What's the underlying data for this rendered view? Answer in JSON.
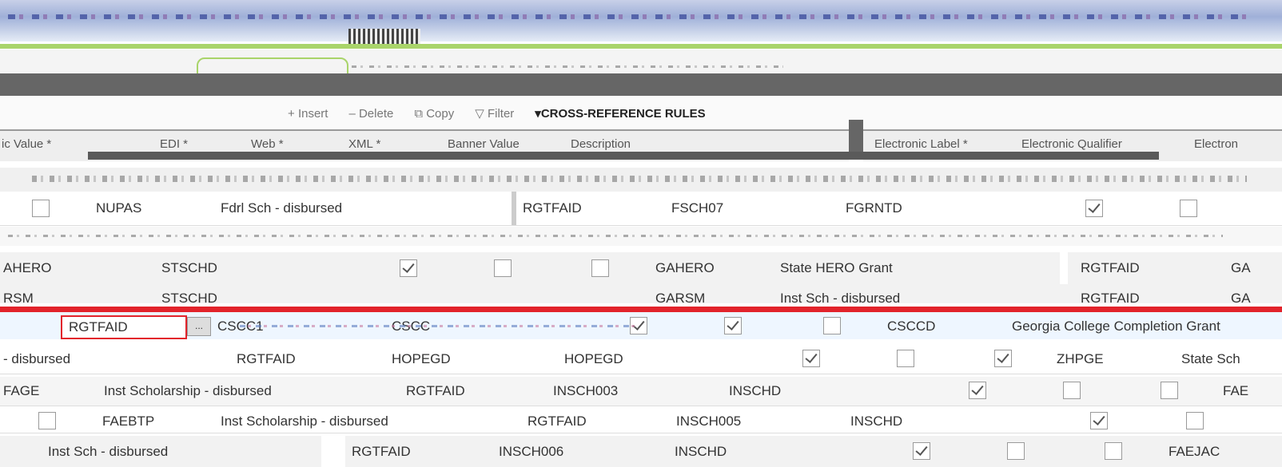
{
  "colors": {
    "accent_green": "#a9d46a",
    "highlight_red": "#e2232b",
    "header_gray": "#dadada",
    "toolbar_dark": "#666666"
  },
  "toolbar": {
    "insert": "Insert",
    "delete": "Delete",
    "copy": "Copy",
    "filter": "Filter",
    "section_title": "CROSS-REFERENCE RULES"
  },
  "columns_left": [
    "ic Value *",
    "EDI *",
    "Web *",
    "XML *",
    "Banner Value",
    "Description"
  ],
  "columns_right": [
    "Electronic Label *",
    "Electronic Qualifier",
    "Electron"
  ],
  "row1": {
    "value": "NUPAS",
    "description": "Fdrl Sch - disbursed",
    "label": "RGTFAID",
    "qualifier": "FSCH07",
    "banner": "FGRNTD"
  },
  "row2": {
    "value": "AHERO",
    "code": "STSCHD",
    "banner": "GAHERO",
    "description": "State HERO Grant",
    "label": "RGTFAID",
    "cut": "GA"
  },
  "row3": {
    "value": "RSM",
    "code": "STSCHD",
    "banner": "GARSM",
    "description": "Inst Sch - disbursed",
    "label": "RGTFAID",
    "cut": "GA"
  },
  "row4": {
    "label": "RGTFAID",
    "qualifier": "CSCC1",
    "code": "CSCC",
    "banner": "CSCCD",
    "description": "Georgia College Completion Grant"
  },
  "row5": {
    "description": "- disbursed",
    "label": "RGTFAID",
    "qualifier": "HOPEGD",
    "banner": "HOPEGD",
    "value": "ZHPGE",
    "cut": "State Sch"
  },
  "row6": {
    "value": "FAGE",
    "description": "Inst Scholarship - disbursed",
    "label": "RGTFAID",
    "qualifier": "INSCH003",
    "banner": "INSCHD",
    "cut": "FAE"
  },
  "row7": {
    "value": "FAEBTP",
    "description": "Inst Scholarship - disbursed",
    "label": "RGTFAID",
    "qualifier": "INSCH005",
    "banner": "INSCHD"
  },
  "row8": {
    "description": "Inst Sch - disbursed",
    "label": "RGTFAID",
    "qualifier": "INSCH006",
    "banner": "INSCHD",
    "value": "FAEJAC"
  }
}
